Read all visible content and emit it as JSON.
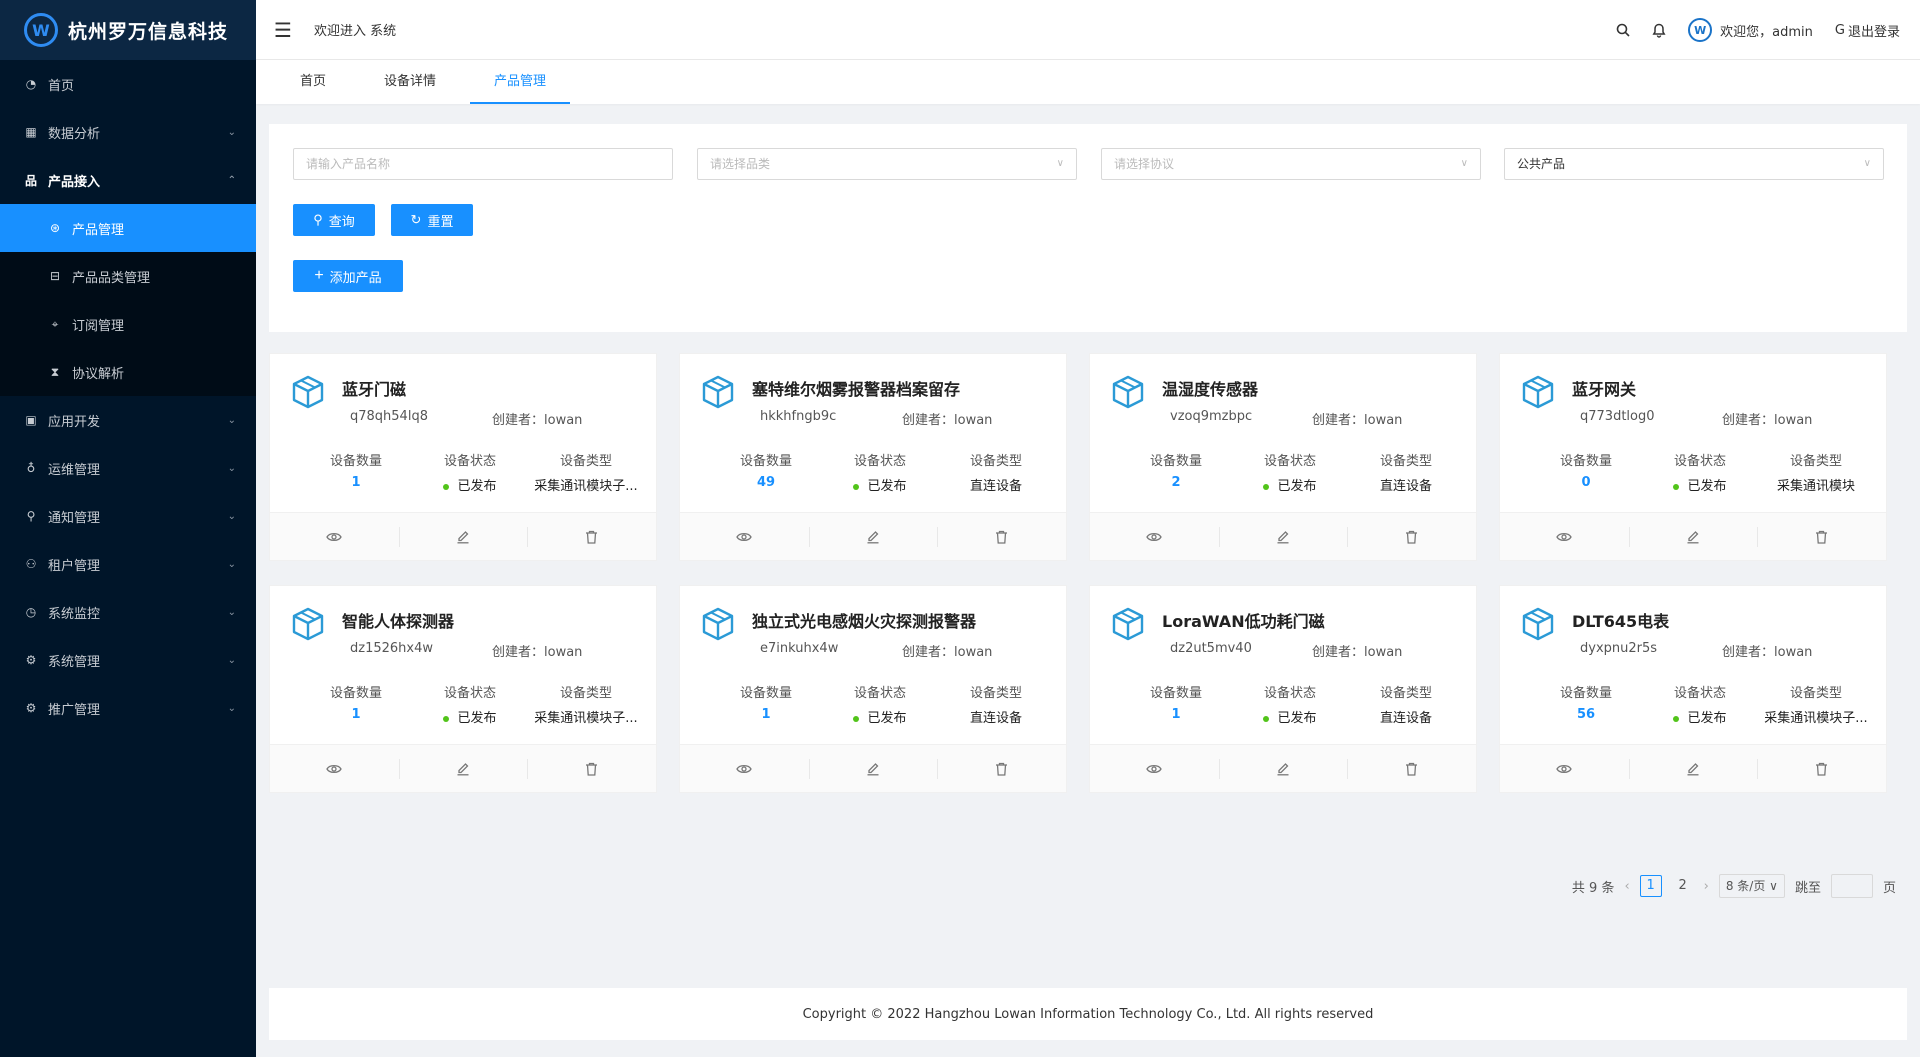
{
  "brand": {
    "title": "杭州罗万信息科技",
    "logo_icon": "lowan-logo"
  },
  "sidebar": {
    "items": [
      {
        "label": "首页",
        "icon": "dashboard-icon"
      },
      {
        "label": "数据分析",
        "icon": "chart-icon"
      },
      {
        "label": "产品接入",
        "icon": "product-icon"
      },
      {
        "label": "应用开发",
        "icon": "app-icon"
      },
      {
        "label": "运维管理",
        "icon": "ops-icon"
      },
      {
        "label": "通知管理",
        "icon": "notify-icon"
      },
      {
        "label": "租户管理",
        "icon": "tenant-icon"
      },
      {
        "label": "系统监控",
        "icon": "monitor-icon"
      },
      {
        "label": "系统管理",
        "icon": "settings-icon"
      },
      {
        "label": "推广管理",
        "icon": "promo-icon"
      }
    ],
    "submenu": [
      {
        "label": "产品管理",
        "icon": "product-manage-icon"
      },
      {
        "label": "产品品类管理",
        "icon": "category-icon"
      },
      {
        "label": "订阅管理",
        "icon": "subscribe-icon"
      },
      {
        "label": "协议解析",
        "icon": "protocol-icon"
      }
    ]
  },
  "header": {
    "welcome": "欢迎进入 系统",
    "user_greeting": "欢迎您，admin",
    "logout": "退出登录"
  },
  "tabs": [
    {
      "label": "首页"
    },
    {
      "label": "设备详情"
    },
    {
      "label": "产品管理",
      "active": true
    }
  ],
  "filter": {
    "name_placeholder": "请输入产品名称",
    "category_placeholder": "请选择品类",
    "protocol_placeholder": "请选择协议",
    "scope_value": "公共产品",
    "search_label": "查询",
    "reset_label": "重置",
    "add_label": "添加产品"
  },
  "card_labels": {
    "creator_prefix": "创建者：",
    "device_count": "设备数量",
    "device_status": "设备状态",
    "device_type": "设备类型"
  },
  "products": [
    {
      "name": "蓝牙门磁",
      "id": "q78qh54lq8",
      "creator": "lowan",
      "count": "1",
      "status": "已发布",
      "type": "采集通讯模块子..."
    },
    {
      "name": "塞特维尔烟雾报警器档案留存",
      "id": "hkkhfngb9c",
      "creator": "lowan",
      "count": "49",
      "status": "已发布",
      "type": "直连设备"
    },
    {
      "name": "温湿度传感器",
      "id": "vzoq9mzbpc",
      "creator": "lowan",
      "count": "2",
      "status": "已发布",
      "type": "直连设备"
    },
    {
      "name": "蓝牙网关",
      "id": "q773dtlog0",
      "creator": "lowan",
      "count": "0",
      "status": "已发布",
      "type": "采集通讯模块"
    },
    {
      "name": "智能人体探测器",
      "id": "dz1526hx4w",
      "creator": "lowan",
      "count": "1",
      "status": "已发布",
      "type": "采集通讯模块子..."
    },
    {
      "name": "独立式光电感烟火灾探测报警器",
      "id": "e7inkuhx4w",
      "creator": "lowan",
      "count": "1",
      "status": "已发布",
      "type": "直连设备"
    },
    {
      "name": "LoraWAN低功耗门磁",
      "id": "dz2ut5mv40",
      "creator": "lowan",
      "count": "1",
      "status": "已发布",
      "type": "直连设备"
    },
    {
      "name": "DLT645电表",
      "id": "dyxpnu2r5s",
      "creator": "lowan",
      "count": "56",
      "status": "已发布",
      "type": "采集通讯模块子..."
    }
  ],
  "pagination": {
    "total": "共 9 条",
    "pages": [
      "1",
      "2"
    ],
    "current": "1",
    "page_size": "8 条/页",
    "jump_prefix": "跳至",
    "jump_suffix": "页"
  },
  "footer": {
    "copyright": "Copyright © 2022 Hangzhou Lowan Information Technology Co., Ltd. All rights reserved"
  },
  "colors": {
    "accent": "#1890ff",
    "sidebar_bg": "#001529",
    "status_dot": "#52c41a"
  }
}
